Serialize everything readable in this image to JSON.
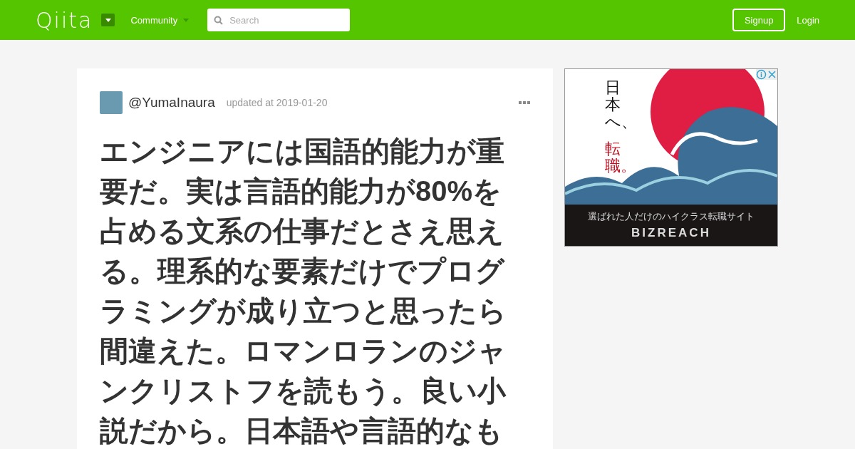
{
  "header": {
    "logo": "Qiita",
    "menu": {
      "label": "Community"
    },
    "search": {
      "placeholder": "Search"
    },
    "signup": "Signup",
    "login": "Login"
  },
  "article": {
    "author": "@YumaInaura",
    "updated": "updated at 2019-01-20",
    "title": "エンジニアには国語的能力が重要だ。実は言語的能力が80%を占める文系の仕事だとさえ思える。理系的な要素だけでプログラミングが成り立つと思ったら間違えた。ロマンロランのジャンクリストフを読もう。良い小説だから。日本語や言語的なも"
  },
  "ad": {
    "headline": "日本へ、",
    "emphasis": "転職。",
    "tagline": "選ばれた人だけのハイクラス転職サイト",
    "brand": "BIZREACH"
  }
}
